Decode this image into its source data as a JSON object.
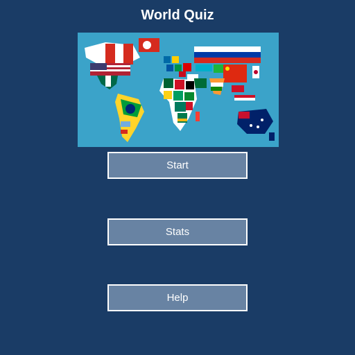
{
  "app": {
    "title": "World Quiz"
  },
  "menu": {
    "start_label": "Start",
    "stats_label": "Stats",
    "help_label": "Help"
  },
  "image": {
    "icon": "world-flag-map-icon"
  },
  "colors": {
    "background": "#1a3c66",
    "ocean": "#3ba3c9",
    "button": "#6883a3",
    "button_border": "#ffffff",
    "text": "#ffffff"
  }
}
